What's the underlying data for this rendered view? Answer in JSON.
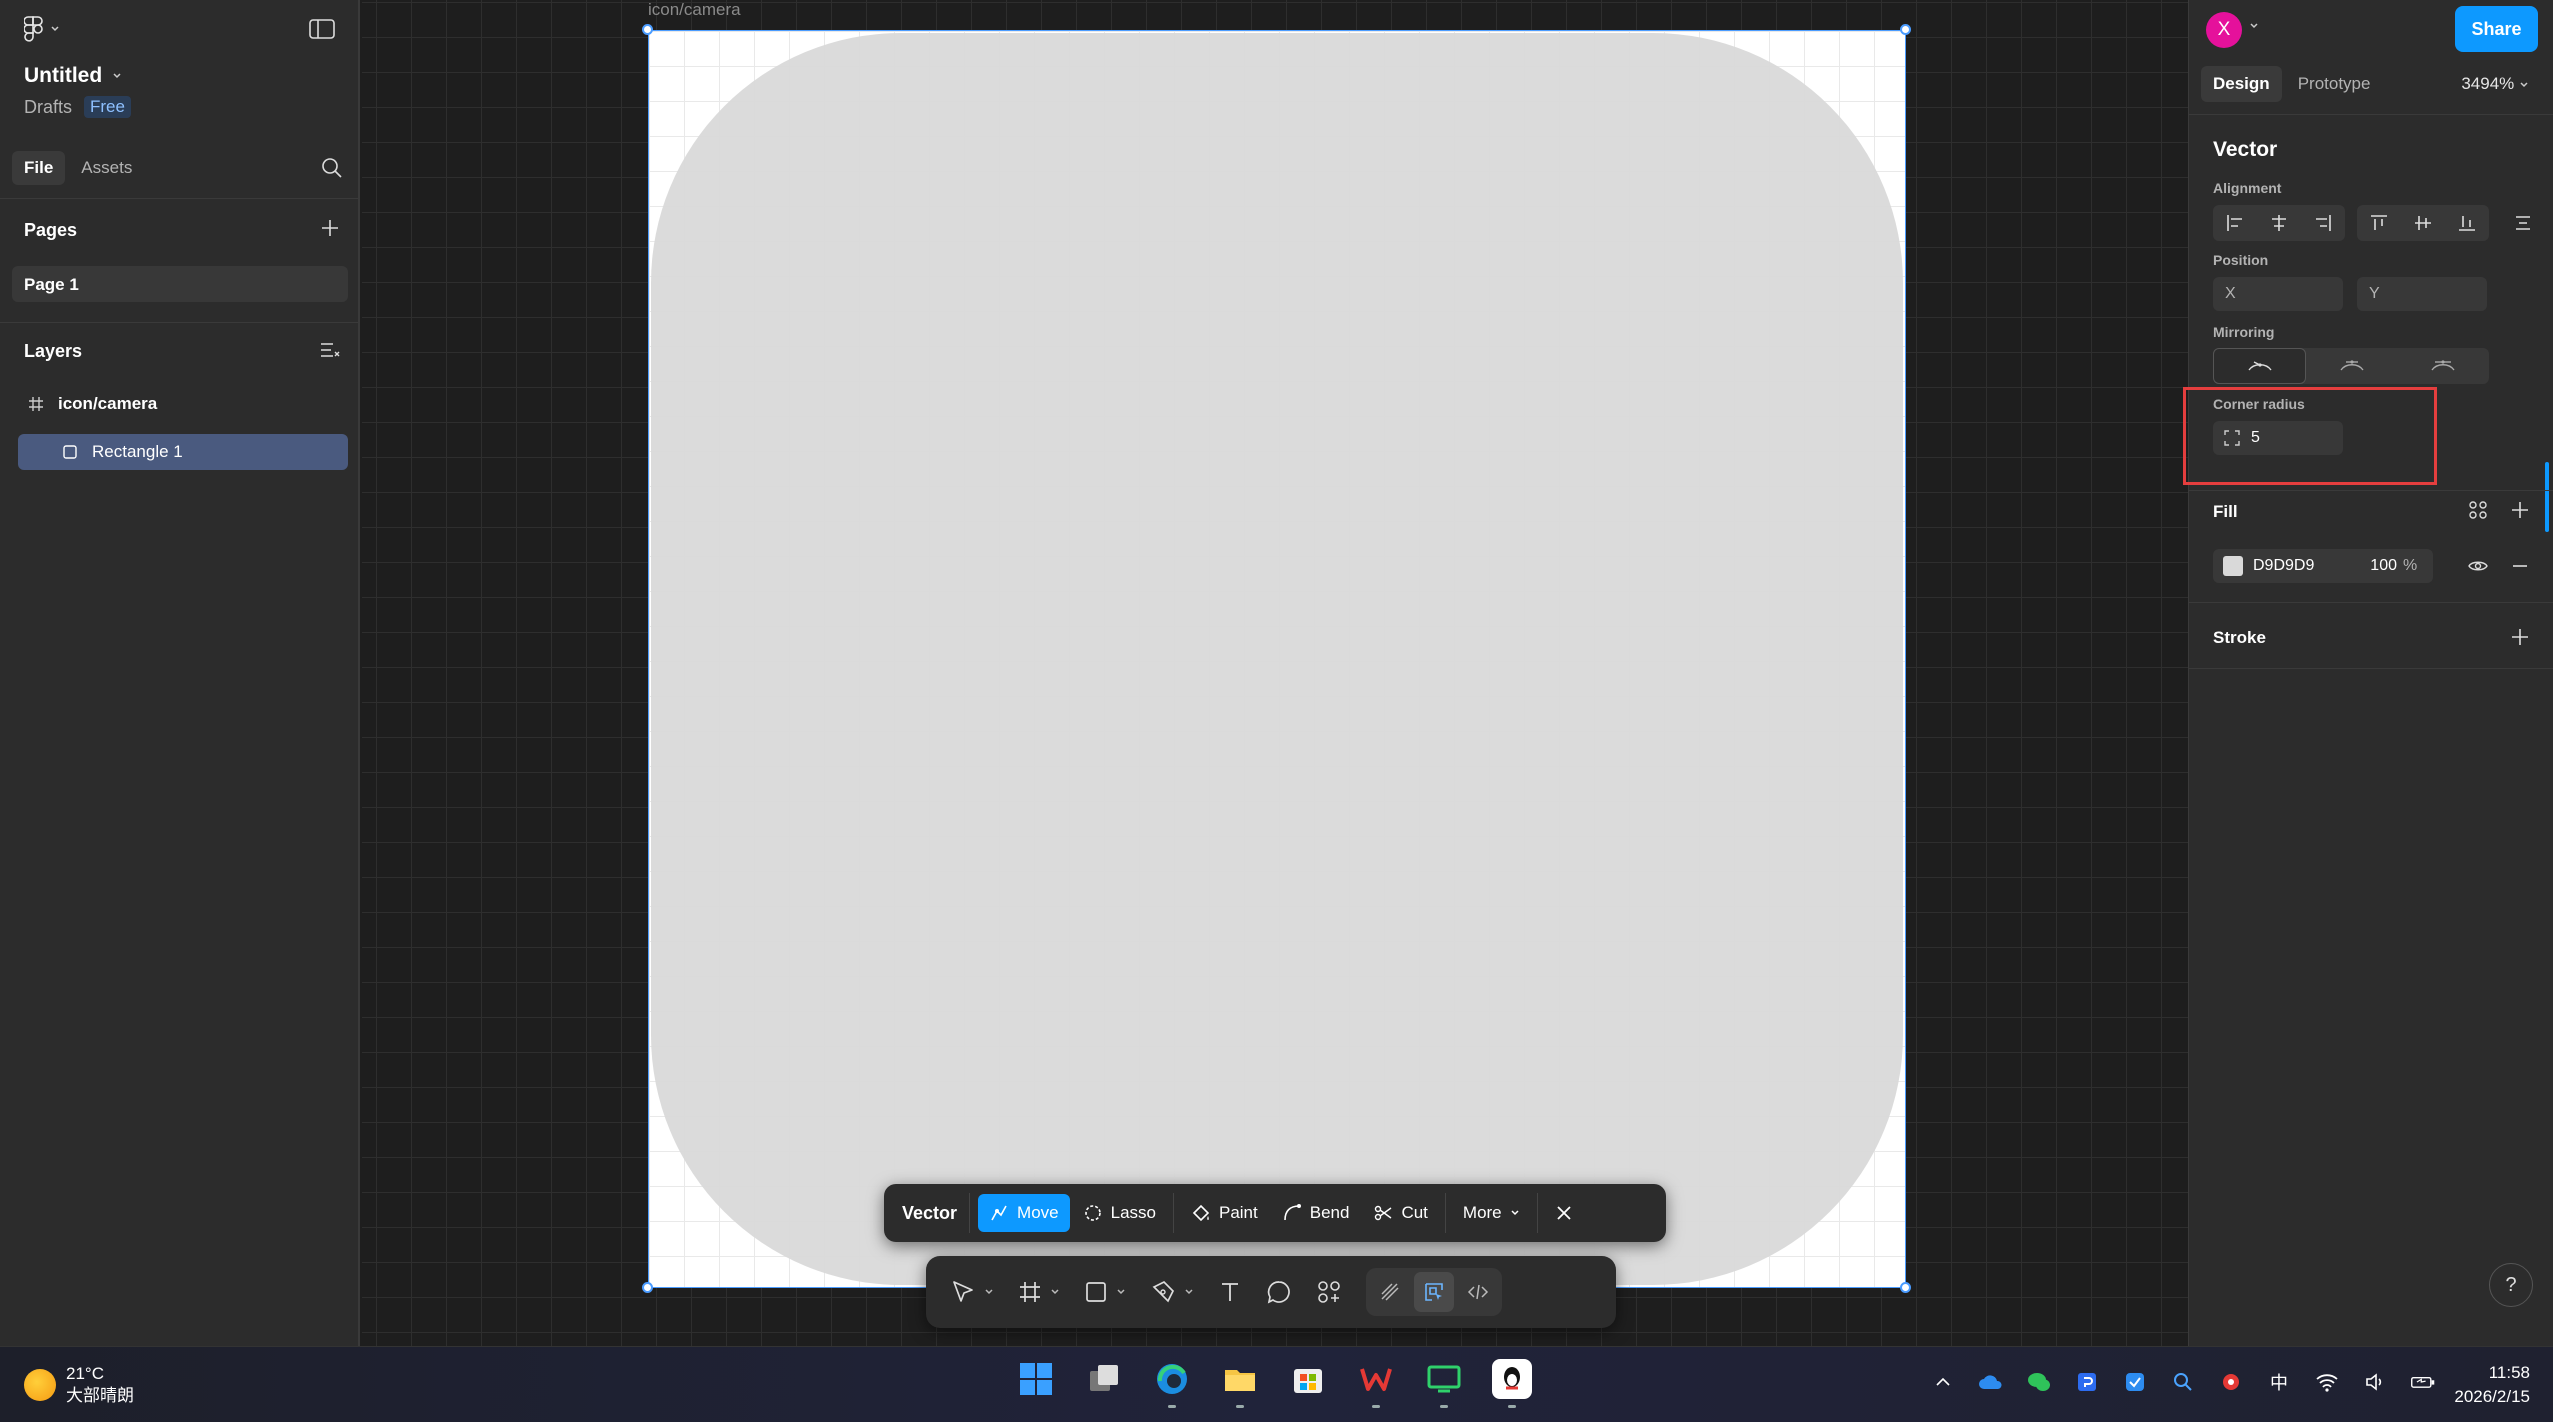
{
  "app": {
    "file_title": "Untitled",
    "location": "Drafts",
    "plan_badge": "Free"
  },
  "left_panel": {
    "tabs": [
      {
        "label": "File",
        "active": true
      },
      {
        "label": "Assets",
        "active": false
      }
    ],
    "pages_title": "Pages",
    "pages": [
      {
        "label": "Page 1",
        "selected": true
      }
    ],
    "layers_title": "Layers",
    "layers": [
      {
        "label": "icon/camera",
        "icon": "frame-icon",
        "selected": false
      },
      {
        "label": "Rectangle 1",
        "icon": "rectangle-icon",
        "selected": true
      }
    ]
  },
  "canvas": {
    "frame_label": "icon/camera",
    "shape_fill": "#D9D9D9"
  },
  "vector_toolbar": {
    "title": "Vector",
    "buttons": [
      {
        "label": "Move",
        "icon": "move-icon",
        "active": true
      },
      {
        "label": "Lasso",
        "icon": "lasso-icon",
        "active": false
      },
      {
        "label": "Paint",
        "icon": "paint-icon",
        "active": false
      },
      {
        "label": "Bend",
        "icon": "bend-icon",
        "active": false
      },
      {
        "label": "Cut",
        "icon": "cut-icon",
        "active": false
      }
    ],
    "more_label": "More"
  },
  "bottom_toolbar": {
    "tools": [
      "move-tool-icon",
      "frame-tool-icon",
      "rectangle-tool-icon",
      "pen-tool-icon",
      "text-tool-icon",
      "comment-tool-icon",
      "actions-tool-icon"
    ],
    "mode_buttons": [
      "draw-mode-icon",
      "design-mode-icon",
      "dev-mode-icon"
    ]
  },
  "right_panel": {
    "avatar_initial": "X",
    "share_label": "Share",
    "tabs": [
      {
        "label": "Design",
        "active": true
      },
      {
        "label": "Prototype",
        "active": false
      }
    ],
    "zoom": "3494%",
    "section_title": "Vector",
    "alignment_label": "Alignment",
    "position_label": "Position",
    "position_x_placeholder": "X",
    "position_y_placeholder": "Y",
    "mirroring_label": "Mirroring",
    "corner_radius_label": "Corner radius",
    "corner_radius_value": "5",
    "fill_title": "Fill",
    "fill_hex": "D9D9D9",
    "fill_opacity": "100",
    "fill_opacity_unit": "%",
    "stroke_title": "Stroke",
    "help_label": "?"
  },
  "taskbar": {
    "temperature": "21°C",
    "weather_desc": "大部晴朗",
    "tray_ime": "中",
    "time": "11:58",
    "date": "2026/2/15"
  },
  "colors": {
    "accent": "#0d99ff",
    "highlight": "#e53e3e",
    "avatar": "#e5119b"
  }
}
